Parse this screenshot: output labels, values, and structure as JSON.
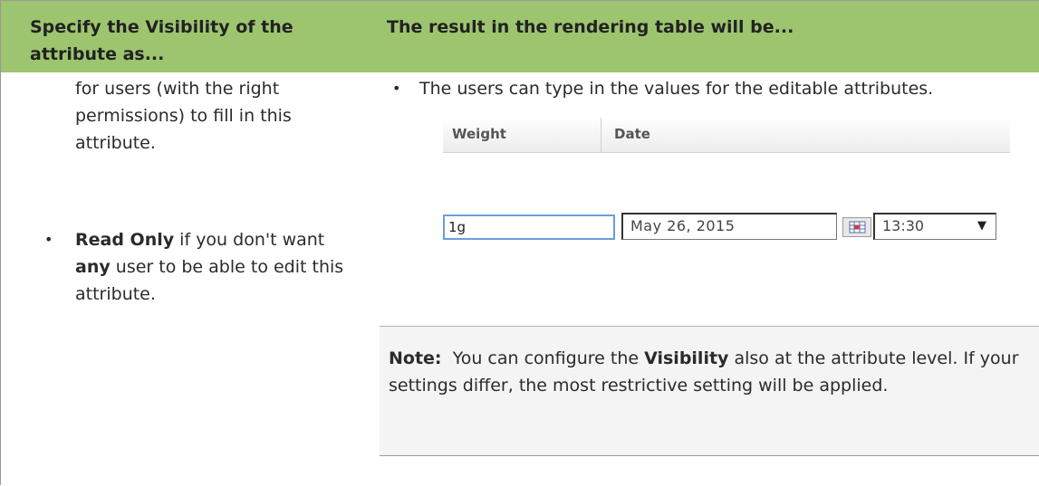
{
  "table": {
    "header": {
      "left": "Specify the Visibility of the attribute as...",
      "right": "The result in the rendering table will be..."
    },
    "left": {
      "continuation": "for users (with the right permissions) to fill in this attribute.",
      "bullet": {
        "strong_label": "Read Only",
        "text_1": " if you don't want ",
        "strong_any": "any",
        "text_2": " user to be able to edit this attribute."
      }
    },
    "right": {
      "bullet": "The users can type in the values for the editable attributes.",
      "sample": {
        "columns": [
          "Weight",
          "Date"
        ],
        "weight_value": "1g",
        "date_value": "May 26, 2015",
        "time_value": "13:30",
        "time_arrow": "▼",
        "calendar_icon": "calendar-icon"
      },
      "note": {
        "label": "Note:",
        "text_1": "  You can configure the ",
        "strong": "Visibility",
        "text_2": " also at the attribute level. If your settings differ, the most restrictive setting will be applied."
      }
    }
  },
  "colors": {
    "header_bg": "#9dc56f",
    "note_bg": "#f4f4f4",
    "input_focus": "#6a9ed8"
  }
}
